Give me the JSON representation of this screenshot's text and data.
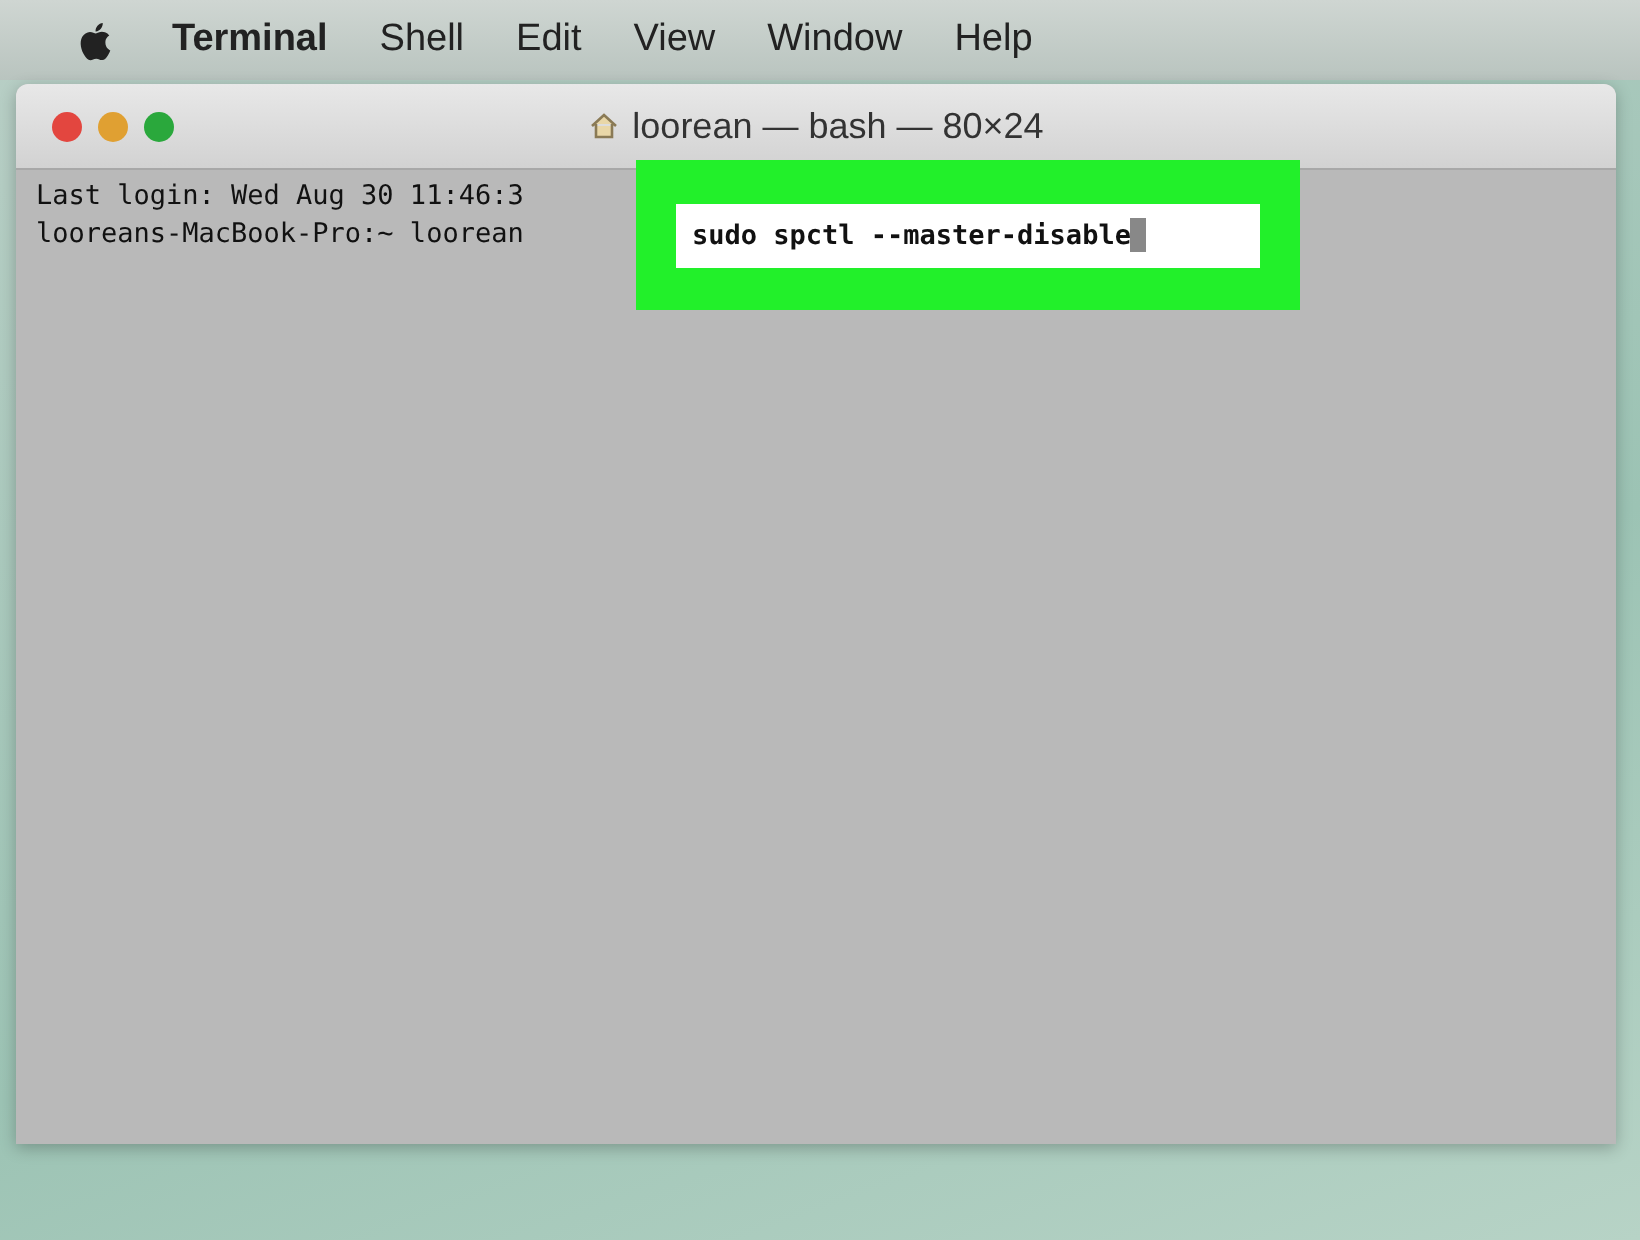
{
  "menu_bar": {
    "items": [
      {
        "label": "Terminal",
        "bold": true
      },
      {
        "label": "Shell",
        "bold": false
      },
      {
        "label": "Edit",
        "bold": false
      },
      {
        "label": "View",
        "bold": false
      },
      {
        "label": "Window",
        "bold": false
      },
      {
        "label": "Help",
        "bold": false
      }
    ]
  },
  "window": {
    "title": "loorean — bash — 80×24"
  },
  "terminal": {
    "lines": [
      "Last login: Wed Aug 30 11:46:3",
      "looreans-MacBook-Pro:~ loorean"
    ]
  },
  "highlight": {
    "command": "sudo spctl --master-disable"
  }
}
